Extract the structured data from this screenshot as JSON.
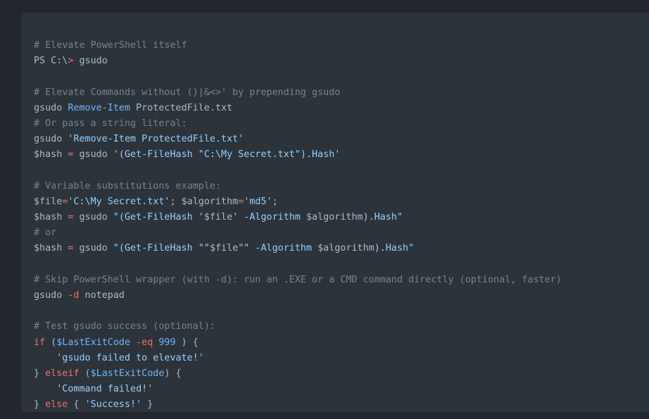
{
  "code": {
    "language": "powershell",
    "lines": [
      [
        {
          "t": "c",
          "x": "# Elevate PowerShell itself"
        }
      ],
      [
        {
          "t": "v",
          "x": "PS C:\\"
        },
        {
          "t": "k",
          "x": ">"
        },
        {
          "t": "v",
          "x": " gsudo"
        }
      ],
      [],
      [
        {
          "t": "c",
          "x": "# Elevate Commands without ()|&<>' by prepending gsudo"
        }
      ],
      [
        {
          "t": "v",
          "x": "gsudo "
        },
        {
          "t": "b",
          "x": "Remove-Item"
        },
        {
          "t": "v",
          "x": " ProtectedFile.txt"
        }
      ],
      [
        {
          "t": "c",
          "x": "# Or pass a string literal:"
        }
      ],
      [
        {
          "t": "v",
          "x": "gsudo "
        },
        {
          "t": "s",
          "x": "'Remove-Item ProtectedFile.txt'"
        }
      ],
      [
        {
          "t": "v",
          "x": "$hash "
        },
        {
          "t": "k",
          "x": "="
        },
        {
          "t": "v",
          "x": " gsudo "
        },
        {
          "t": "s",
          "x": "'(Get-FileHash \"C:\\My Secret.txt\").Hash'"
        }
      ],
      [],
      [
        {
          "t": "c",
          "x": "# Variable substitutions example:"
        }
      ],
      [
        {
          "t": "v",
          "x": "$file"
        },
        {
          "t": "k",
          "x": "="
        },
        {
          "t": "s",
          "x": "'C:\\My Secret.txt'"
        },
        {
          "t": "v",
          "x": "; $algorithm"
        },
        {
          "t": "k",
          "x": "="
        },
        {
          "t": "s",
          "x": "'md5'"
        },
        {
          "t": "v",
          "x": ";"
        }
      ],
      [
        {
          "t": "v",
          "x": "$hash "
        },
        {
          "t": "k",
          "x": "="
        },
        {
          "t": "v",
          "x": " gsudo "
        },
        {
          "t": "s",
          "x": "\"(Get-FileHash '"
        },
        {
          "t": "v",
          "x": "$file"
        },
        {
          "t": "s",
          "x": "' -Algorithm "
        },
        {
          "t": "v",
          "x": "$algorithm"
        },
        {
          "t": "s",
          "x": ").Hash\""
        }
      ],
      [
        {
          "t": "c",
          "x": "# or"
        }
      ],
      [
        {
          "t": "v",
          "x": "$hash "
        },
        {
          "t": "k",
          "x": "="
        },
        {
          "t": "v",
          "x": " gsudo "
        },
        {
          "t": "s",
          "x": "\"(Get-FileHash \"\""
        },
        {
          "t": "v",
          "x": "$file"
        },
        {
          "t": "s",
          "x": "\"\" -Algorithm "
        },
        {
          "t": "v",
          "x": "$algorithm"
        },
        {
          "t": "s",
          "x": ").Hash\""
        }
      ],
      [],
      [
        {
          "t": "c",
          "x": "# Skip PowerShell wrapper (with -d): run an .EXE or a CMD command directly (optional, faster)"
        }
      ],
      [
        {
          "t": "v",
          "x": "gsudo "
        },
        {
          "t": "k",
          "x": "-d"
        },
        {
          "t": "v",
          "x": " notepad"
        }
      ],
      [],
      [
        {
          "t": "c",
          "x": "# Test gsudo success (optional):"
        }
      ],
      [
        {
          "t": "k",
          "x": "if"
        },
        {
          "t": "v",
          "x": " ("
        },
        {
          "t": "b",
          "x": "$LastExitCode"
        },
        {
          "t": "v",
          "x": " "
        },
        {
          "t": "k",
          "x": "-eq"
        },
        {
          "t": "v",
          "x": " "
        },
        {
          "t": "b",
          "x": "999"
        },
        {
          "t": "v",
          "x": " ) {"
        }
      ],
      [
        {
          "t": "v",
          "x": "    "
        },
        {
          "t": "s",
          "x": "'gsudo failed to elevate!'"
        }
      ],
      [
        {
          "t": "v",
          "x": "} "
        },
        {
          "t": "k",
          "x": "elseif"
        },
        {
          "t": "v",
          "x": " ("
        },
        {
          "t": "b",
          "x": "$LastExitCode"
        },
        {
          "t": "v",
          "x": ") {"
        }
      ],
      [
        {
          "t": "v",
          "x": "    "
        },
        {
          "t": "s",
          "x": "'Command failed!'"
        }
      ],
      [
        {
          "t": "v",
          "x": "} "
        },
        {
          "t": "k",
          "x": "else"
        },
        {
          "t": "v",
          "x": " { "
        },
        {
          "t": "s",
          "x": "'Success!'"
        },
        {
          "t": "v",
          "x": " }"
        }
      ]
    ]
  },
  "colors": {
    "page_background": "#22272e",
    "code_background": "#2d333b",
    "comment": "#768390",
    "keyword_operator": "#f47067",
    "string": "#96d0ff",
    "builtin": "#6cb6ff",
    "text": "#adbac7"
  }
}
